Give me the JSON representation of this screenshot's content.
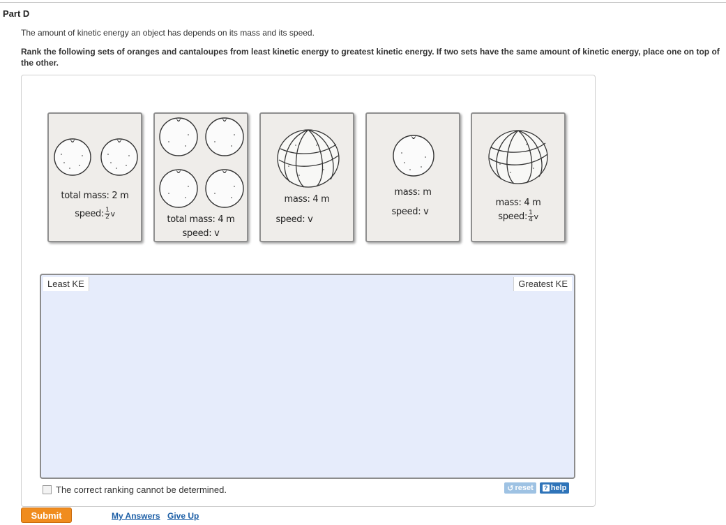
{
  "part": {
    "title": "Part D"
  },
  "intro": "The amount of kinetic energy an object has depends on its mass and its speed.",
  "instructions": "Rank the following sets of oranges and cantaloupes from least kinetic energy to greatest kinetic energy. If two sets have the same amount of kinetic energy, place one on top of the other.",
  "cards": [
    {
      "item": "two-oranges",
      "mass_label": "total mass: 2 m",
      "speed_label": "speed:",
      "speed_num": "1",
      "speed_den": "2",
      "speed_unit": "v"
    },
    {
      "item": "four-oranges",
      "mass_label": "total mass: 4 m",
      "speed_label": "speed: v"
    },
    {
      "item": "cantaloupe",
      "mass_label": "mass: 4 m",
      "speed_label": "speed: v"
    },
    {
      "item": "one-orange",
      "mass_label": "mass: m",
      "speed_label": "speed: v"
    },
    {
      "item": "cantaloupe",
      "mass_label": "mass: 4 m",
      "speed_label": "speed:",
      "speed_num": "1",
      "speed_den": "4",
      "speed_unit": "v"
    }
  ],
  "ranking": {
    "least_label": "Least KE",
    "greatest_label": "Greatest KE"
  },
  "cannot_determine": "The correct ranking cannot be determined.",
  "buttons": {
    "reset": "reset",
    "help": "help",
    "help_icon": "?",
    "submit": "Submit"
  },
  "links": {
    "my_answers": "My Answers",
    "give_up": "Give Up"
  },
  "colors": {
    "drop_area": "#e6ecfb",
    "submit": "#f08c1e",
    "help": "#2f74b9",
    "reset": "#9ec2e3",
    "link": "#1d5fa6"
  }
}
